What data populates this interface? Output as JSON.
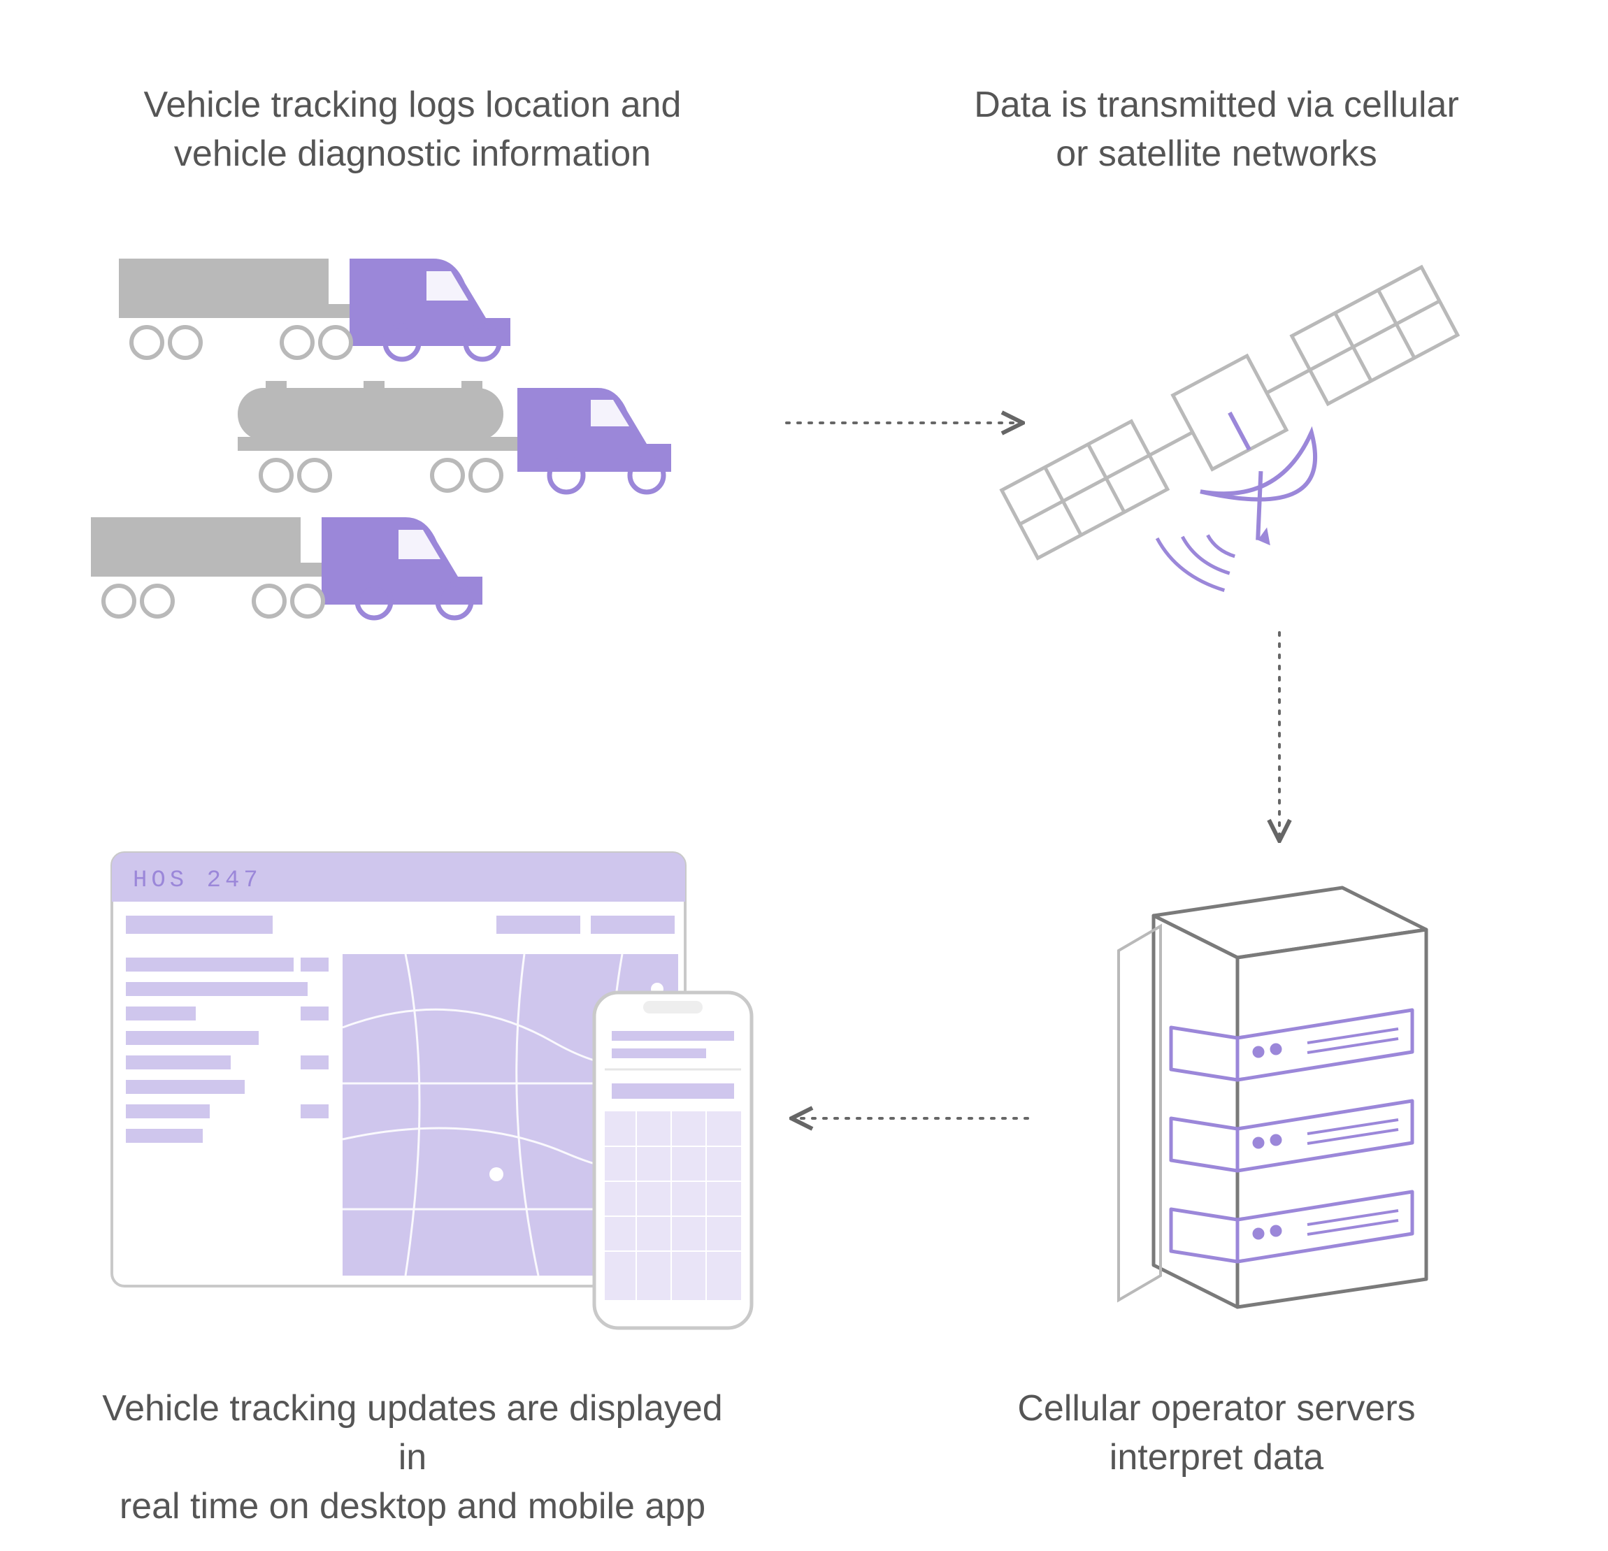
{
  "nodes": {
    "trucks": {
      "line1": "Vehicle tracking logs location and",
      "line2": "vehicle diagnostic information"
    },
    "satellite": {
      "line1": "Data is transmitted via cellular",
      "line2": "or satellite networks"
    },
    "servers": {
      "line1": "Cellular operator servers",
      "line2": "interpret data"
    },
    "dashboard": {
      "line1": "Vehicle tracking updates are displayed in",
      "line2": "real time on desktop and mobile app"
    }
  },
  "app_title": "HOS 247",
  "colors": {
    "accent": "#9b87d9",
    "accent_pale": "#cfc6ed",
    "grey": "#b9b9b9",
    "outline": "#7a7a7a",
    "arrow": "#666666"
  }
}
